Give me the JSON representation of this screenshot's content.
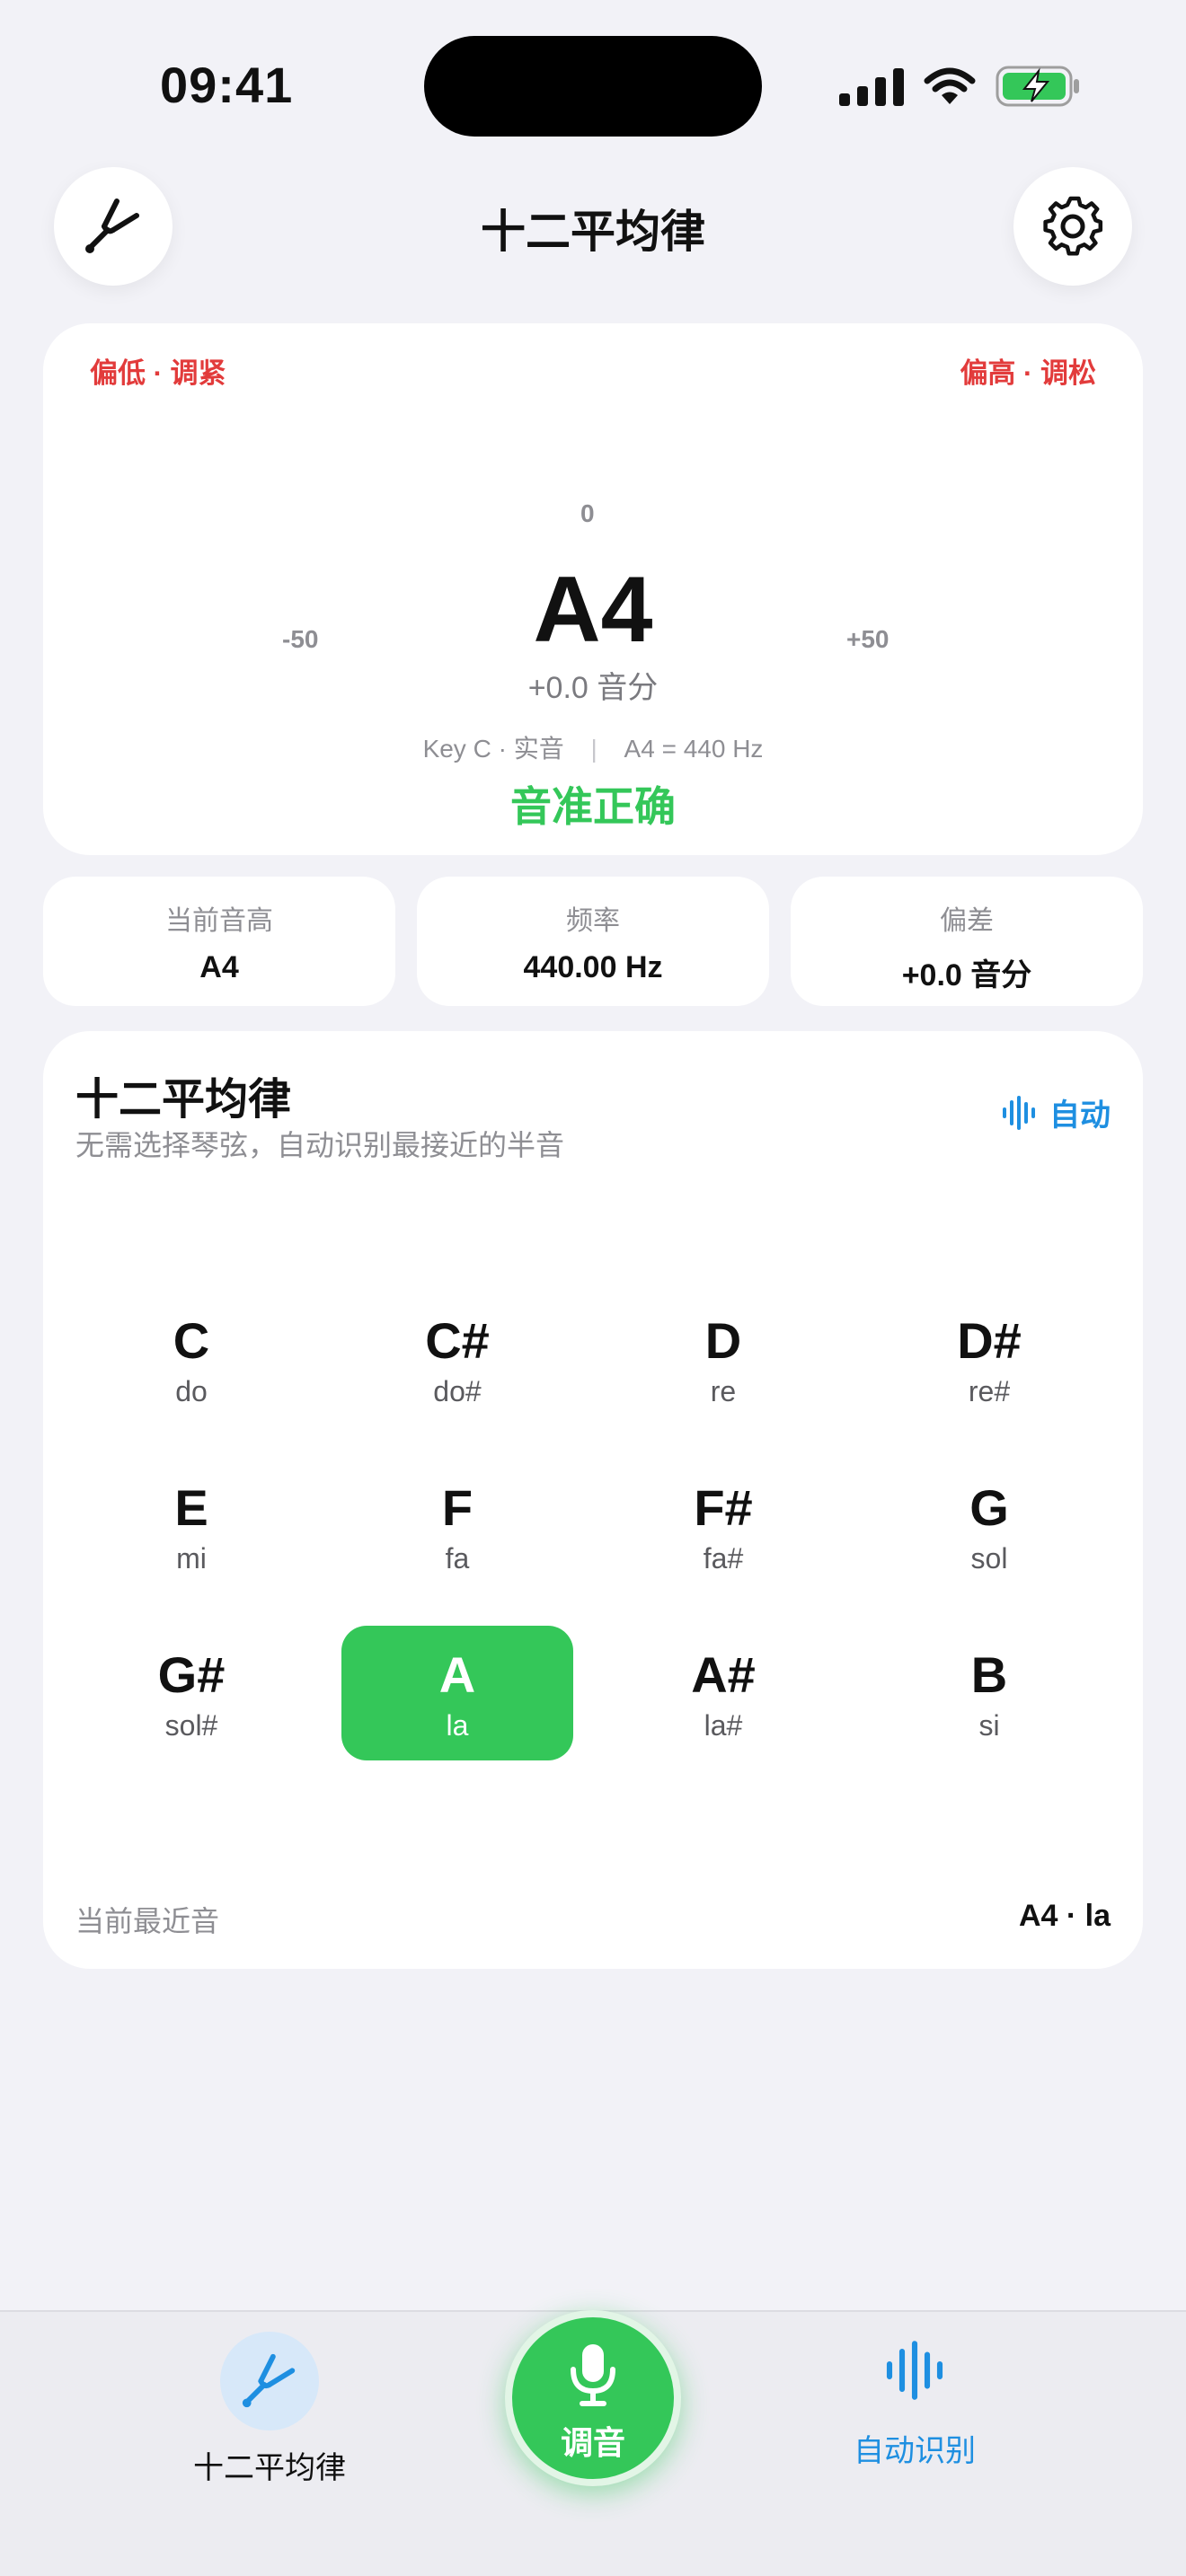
{
  "status_bar": {
    "time": "09:41"
  },
  "header": {
    "title": "十二平均律"
  },
  "gauge": {
    "hint_low": "偏低 · 调紧",
    "hint_high": "偏高 · 调松",
    "scale_zero": "0",
    "scale_min": "-50",
    "scale_max": "+50",
    "note": "A4",
    "cents": "+0.0 音分",
    "key_info": "Key C · 实音",
    "separator": "|",
    "ref_info": "A4 = 440 Hz",
    "status": "音准正确",
    "colors": {
      "in_tune": "#34c759",
      "warn": "#f4a922",
      "off": "#ef4242"
    }
  },
  "stats": [
    {
      "label": "当前音高",
      "value": "A4"
    },
    {
      "label": "频率",
      "value": "440.00 Hz"
    },
    {
      "label": "偏差",
      "value": "+0.0 音分"
    }
  ],
  "notes_panel": {
    "title": "十二平均律",
    "subtitle": "无需选择琴弦，自动识别最接近的半音",
    "mode": "自动",
    "notes": [
      {
        "name": "C",
        "solfege": "do"
      },
      {
        "name": "C#",
        "solfege": "do#"
      },
      {
        "name": "D",
        "solfege": "re"
      },
      {
        "name": "D#",
        "solfege": "re#"
      },
      {
        "name": "E",
        "solfege": "mi"
      },
      {
        "name": "F",
        "solfege": "fa"
      },
      {
        "name": "F#",
        "solfege": "fa#"
      },
      {
        "name": "G",
        "solfege": "sol"
      },
      {
        "name": "G#",
        "solfege": "sol#"
      },
      {
        "name": "A",
        "solfege": "la",
        "active": true
      },
      {
        "name": "A#",
        "solfege": "la#"
      },
      {
        "name": "B",
        "solfege": "si"
      }
    ],
    "nearest_label": "当前最近音",
    "nearest_value": "A4 · la"
  },
  "tabbar": {
    "left_label": "十二平均律",
    "center_label": "调音",
    "right_label": "自动识别"
  }
}
